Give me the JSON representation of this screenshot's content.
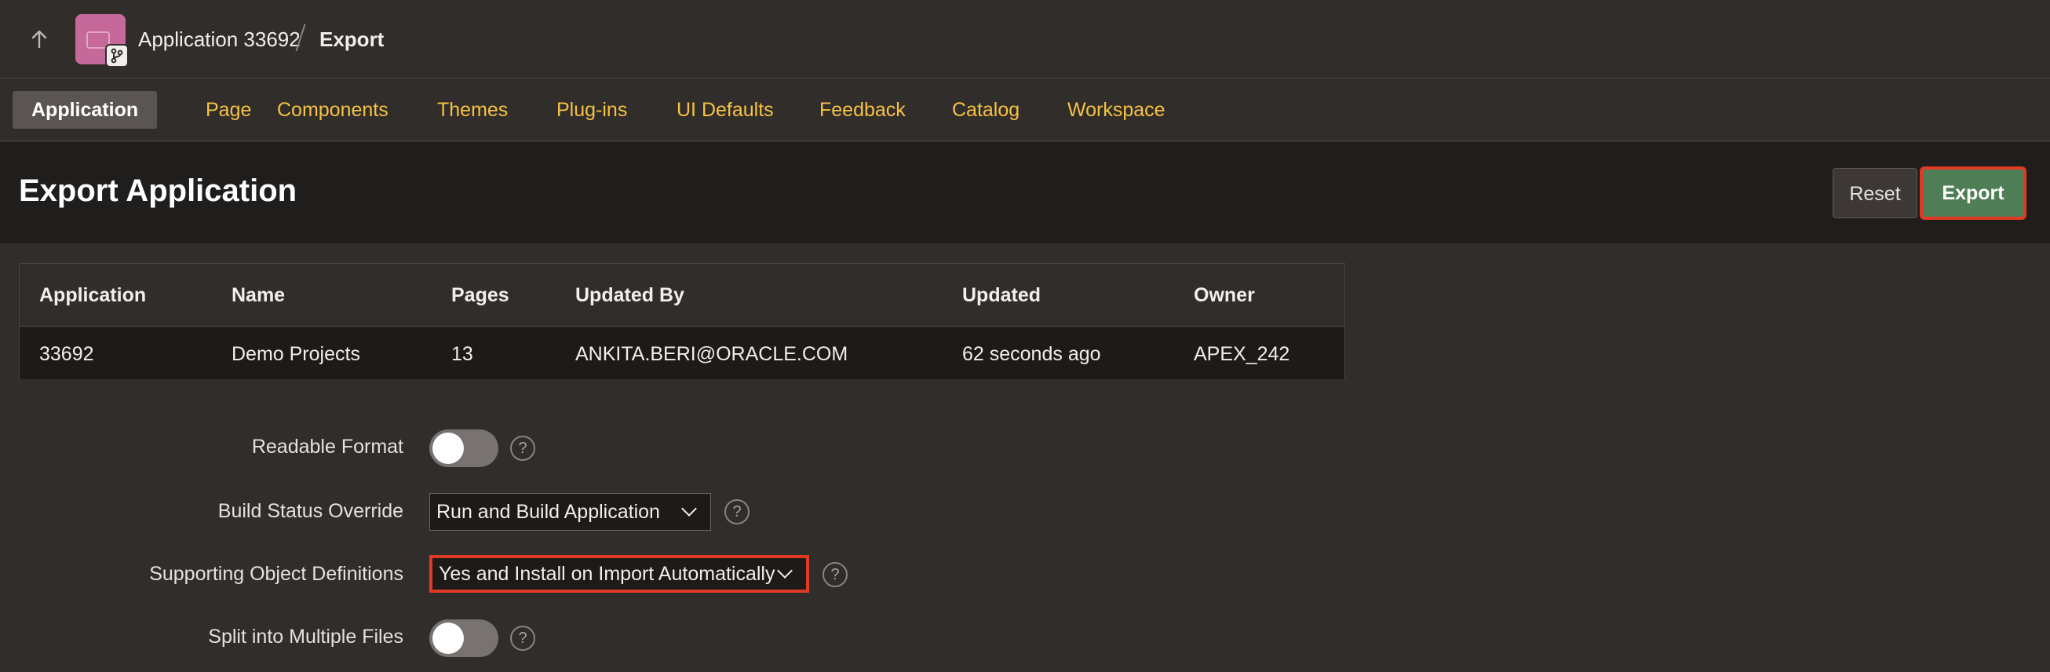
{
  "topbar": {
    "up_icon": "arrow-up-icon",
    "app_icon": "application-icon",
    "badge_icon": "git-branch-icon",
    "app_crumb": "Application 33692",
    "current_crumb": "Export"
  },
  "tabs": [
    {
      "label": "Application",
      "active": true
    },
    {
      "label": "Page"
    },
    {
      "label": "Components"
    },
    {
      "label": "Themes"
    },
    {
      "label": "Plug-ins"
    },
    {
      "label": "UI Defaults"
    },
    {
      "label": "Feedback"
    },
    {
      "label": "Catalog"
    },
    {
      "label": "Workspace"
    }
  ],
  "header": {
    "title": "Export Application",
    "reset_label": "Reset",
    "export_label": "Export"
  },
  "report": {
    "columns": [
      "Application",
      "Name",
      "Pages",
      "Updated By",
      "Updated",
      "Owner"
    ],
    "rows": [
      [
        "33692",
        "Demo Projects",
        "13",
        "ANKITA.BERI@ORACLE.COM",
        "62 seconds ago",
        "APEX_242"
      ]
    ]
  },
  "form": {
    "readable_format": {
      "label": "Readable Format",
      "on": false
    },
    "build_status": {
      "label": "Build Status Override",
      "value": "Run and Build Application"
    },
    "supporting_objects": {
      "label": "Supporting Object Definitions",
      "value": "Yes and Install on Import Automatically"
    },
    "split_files": {
      "label": "Split into Multiple Files",
      "on": false
    },
    "help_glyph": "?"
  },
  "colors": {
    "accent_tab": "#f5c243",
    "export_button": "#4f7d55",
    "highlight_border": "#e03a24",
    "app_icon": "#c5699b"
  }
}
